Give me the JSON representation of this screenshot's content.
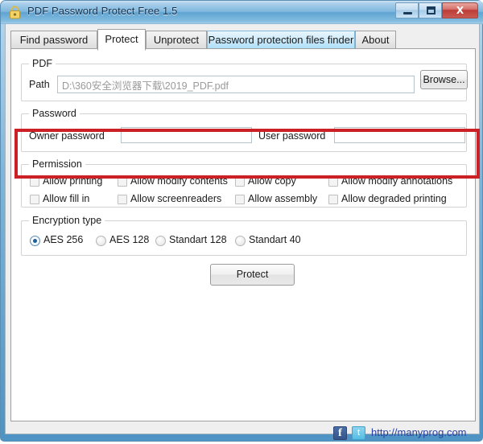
{
  "window": {
    "title": "PDF Password Protect Free 1.5",
    "icon": "padlock-icon",
    "buttons": {
      "minimize": "Minimize",
      "maximize": "Maximize",
      "close": "X"
    }
  },
  "tabs": [
    {
      "label": "Find password",
      "state": "normal"
    },
    {
      "label": "Protect",
      "state": "active"
    },
    {
      "label": "Unprotect",
      "state": "normal"
    },
    {
      "label": "Password protection files finder",
      "state": "hovered"
    },
    {
      "label": "About",
      "state": "normal"
    }
  ],
  "pdf_group": {
    "title": "PDF",
    "path_label": "Path",
    "path_value": "D:\\360安全浏览器下载\\2019_PDF.pdf",
    "browse_label": "Browse..."
  },
  "password_group": {
    "title": "Password",
    "owner_label": "Owner password",
    "owner_value": "",
    "user_label": "User password",
    "user_value": "",
    "highlighted": true,
    "highlight_color": "#cc2027"
  },
  "permission_group": {
    "title": "Permission",
    "items": [
      {
        "label": "Allow printing",
        "checked": false
      },
      {
        "label": "Allow modify contents",
        "checked": false
      },
      {
        "label": "Allow copy",
        "checked": false
      },
      {
        "label": "Allow modify annotations",
        "checked": false
      },
      {
        "label": "Allow fill in",
        "checked": false
      },
      {
        "label": "Allow screenreaders",
        "checked": false
      },
      {
        "label": "Allow assembly",
        "checked": false
      },
      {
        "label": "Allow degraded printing",
        "checked": false
      }
    ]
  },
  "encryption_group": {
    "title": "Encryption type",
    "options": [
      {
        "label": "AES 256",
        "checked": true
      },
      {
        "label": "AES 128",
        "checked": false
      },
      {
        "label": "Standart 128",
        "checked": false
      },
      {
        "label": "Standart 40",
        "checked": false
      }
    ]
  },
  "action": {
    "protect_label": "Protect"
  },
  "footer": {
    "facebook_glyph": "f",
    "twitter_glyph": "t",
    "link_text": "http://manyprog.com",
    "link_color": "#2b3f9e"
  }
}
